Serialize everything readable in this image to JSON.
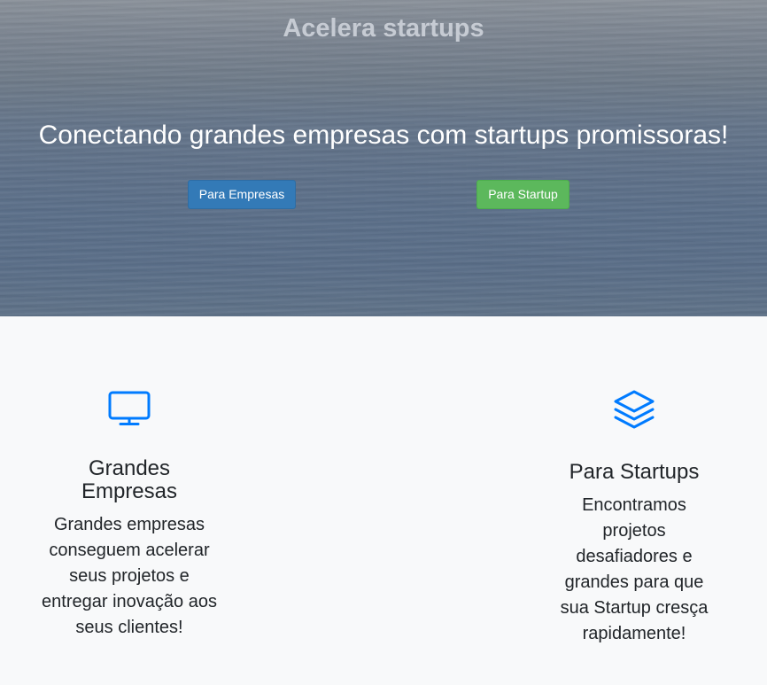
{
  "hero": {
    "brand": "Acelera startups",
    "headline": "Conectando grandes empresas com startups promissoras!",
    "buttons": {
      "empresas": "Para Empresas",
      "startup": "Para Startup"
    }
  },
  "features": [
    {
      "icon": "monitor-icon",
      "title": "Grandes Empresas",
      "text": "Grandes empresas conseguem acelerar seus projetos e entregar inovação aos seus clientes!"
    },
    {
      "icon": "layers-icon",
      "title": "Para Startups",
      "text": "Encontramos projetos desafiadores e grandes para que sua Startup cresça rapidamente!"
    }
  ],
  "colors": {
    "primary": "#337ab7",
    "success": "#5cb85c",
    "icon_blue": "#007bff",
    "section_bg": "#f8f9fa"
  }
}
